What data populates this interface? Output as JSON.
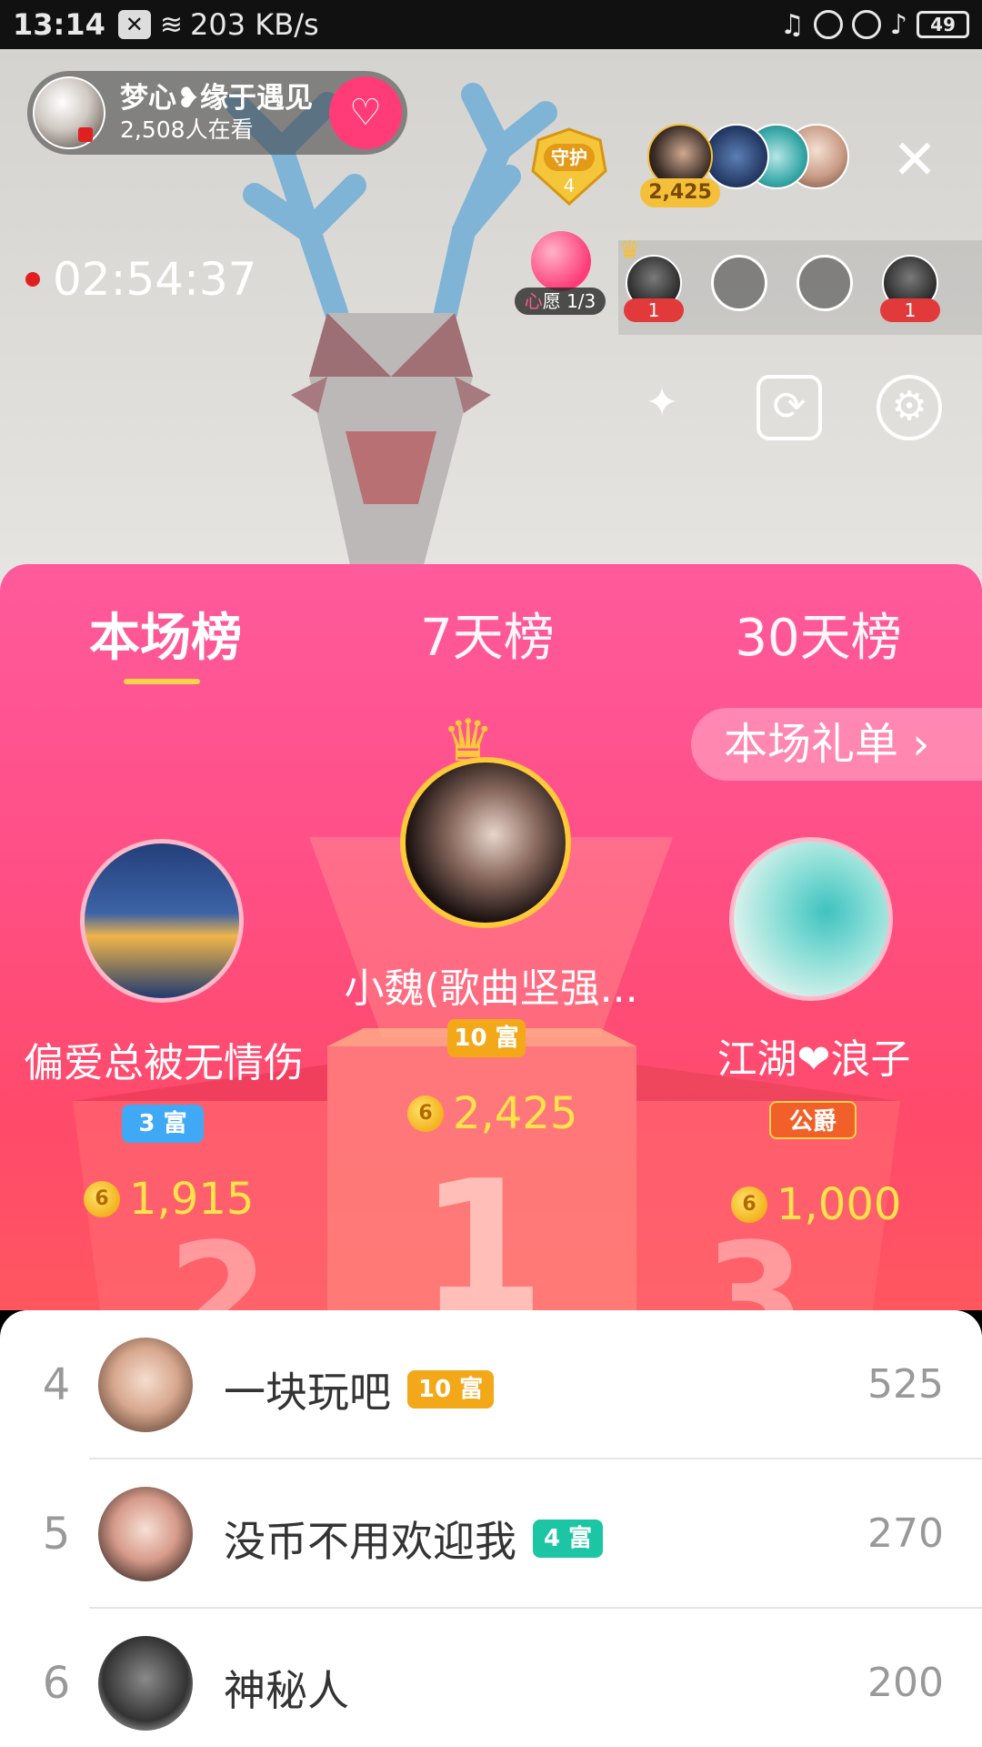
{
  "status_bar": {
    "time": "13:14",
    "network_speed": "203 KB/s",
    "battery": "49"
  },
  "host": {
    "name": "梦心❥缘于遇见",
    "viewers": "2,508人在看"
  },
  "guard": {
    "label": "守护",
    "count": "4"
  },
  "top_viewer_coins": "2,425",
  "live_timer": "02:54:37",
  "wish": {
    "prefix": "心",
    "label": "愿 1/3"
  },
  "seats": {
    "seat1_count": "1",
    "seat4_count": "1"
  },
  "ranking": {
    "tabs": [
      "本场榜",
      "7天榜",
      "30天榜"
    ],
    "active_tab": "本场榜",
    "gift_list_button": "本场礼单 ›",
    "podium": [
      {
        "rank": 1,
        "name": "小魏(歌曲坚强...",
        "badge": "10 富",
        "coins": "2,425",
        "badge_color": "#f3a81a"
      },
      {
        "rank": 2,
        "name": "偏爱总被无情伤",
        "badge": "3 富",
        "coins": "1,915",
        "badge_color": "#3fa9f5"
      },
      {
        "rank": 3,
        "name": "江湖❤浪子",
        "badge": "公爵",
        "coins": "1,000",
        "badge_color": "#f2602a"
      }
    ],
    "list": [
      {
        "rank": "4",
        "name": "一块玩吧",
        "badge": "10 富",
        "badge_color": "#f3a81a",
        "score": "525"
      },
      {
        "rank": "5",
        "name": "没币不用欢迎我",
        "badge": "4 富",
        "badge_color": "#1cc5a4",
        "score": "270"
      },
      {
        "rank": "6",
        "name": "神秘人",
        "badge": "",
        "badge_color": "",
        "score": "200"
      }
    ]
  },
  "colors": {
    "panel_top": "#ff5a9c",
    "panel_bottom": "#ff5660",
    "accent_gold": "#ffe34a",
    "tab_underline": "#ffd34a"
  },
  "icons": {
    "close": "close-icon",
    "magic_wand": "magic-wand-icon",
    "camera_switch": "camera-switch-icon",
    "settings": "gear-icon",
    "follow": "heart-plus-icon",
    "coin": "coin-icon",
    "crown": "crown-icon"
  }
}
